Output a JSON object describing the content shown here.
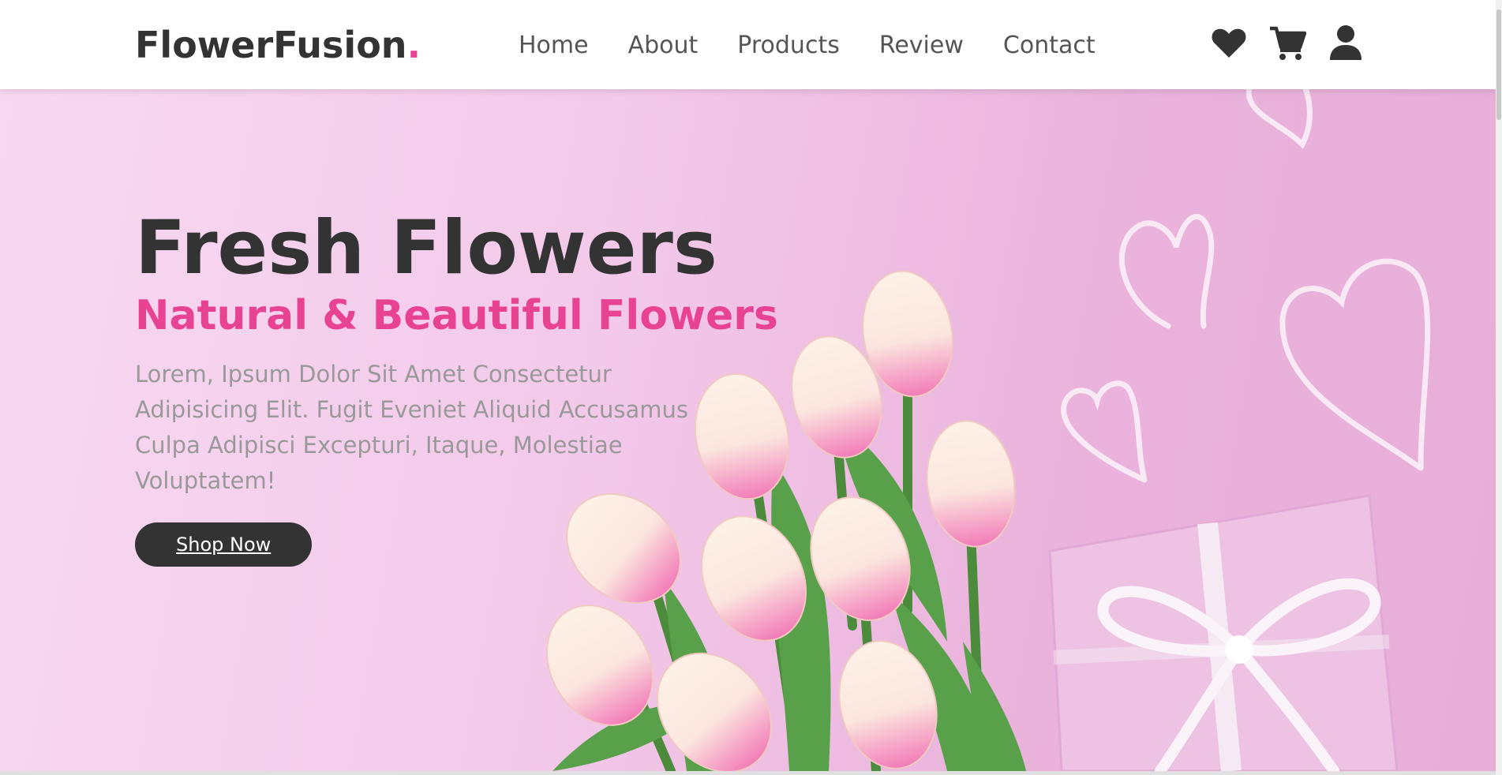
{
  "header": {
    "logo_text": "FlowerFusion",
    "logo_dot": ".",
    "nav": [
      {
        "label": "Home"
      },
      {
        "label": "About"
      },
      {
        "label": "Products"
      },
      {
        "label": "Review"
      },
      {
        "label": "Contact"
      }
    ],
    "icons": [
      "heart-icon",
      "shopping-cart-icon",
      "user-icon"
    ]
  },
  "hero": {
    "title": "Fresh Flowers",
    "subtitle": "Natural & Beautiful Flowers",
    "description": "Lorem, Ipsum Dolor Sit Amet Consectetur Adipisicing Elit. Fugit Eveniet Aliquid Accusamus Culpa Adipisci Excepturi, Itaque, Molestiae Voluptatem!",
    "button_label": "Shop Now"
  },
  "colors": {
    "accent": "#e84393",
    "dark": "#333333",
    "nav_text": "#555555",
    "muted_text": "#999999"
  }
}
